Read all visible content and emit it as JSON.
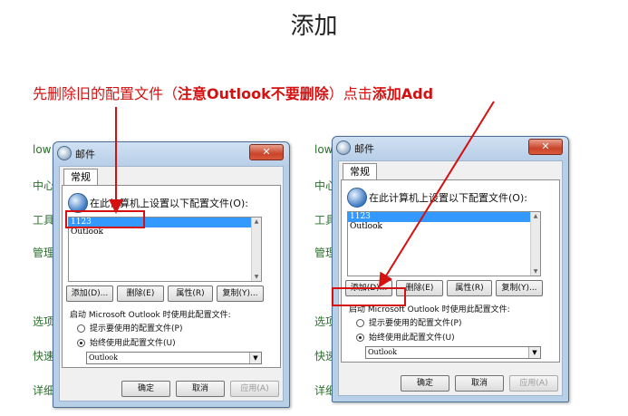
{
  "slide": {
    "title": "添加"
  },
  "instruction": {
    "part1": "先删除旧的配置文件（",
    "part2": "注意Outlook不要删除",
    "part3": "）点击",
    "part4": "添加Add"
  },
  "background_strip": [
    "low",
    "中心",
    "工具",
    "管理",
    "选项",
    "快速",
    "详细"
  ],
  "dialog": {
    "title": "邮件",
    "close_glyph": "✕",
    "tab": "常规",
    "prompt": "在此计算机上设置以下配置文件(O):",
    "profiles": [
      "1123",
      "Outlook"
    ],
    "selected_profile": "1123",
    "buttons": {
      "add": "添加(D)...",
      "delete": "删除(E)",
      "properties": "属性(R)",
      "copy": "复制(Y)..."
    },
    "startup_label": "启动 Microsoft Outlook 时使用此配置文件:",
    "radio_prompt": "提示要使用的配置文件(P)",
    "radio_always": "始终使用此配置文件(U)",
    "always_selected": true,
    "default_profile": "Outlook",
    "ok": "确定",
    "cancel": "取消",
    "apply": "应用(A)"
  },
  "colors": {
    "annotation": "#d41010",
    "selection": "#3399ff",
    "titlebar": "#b8cfe8"
  }
}
